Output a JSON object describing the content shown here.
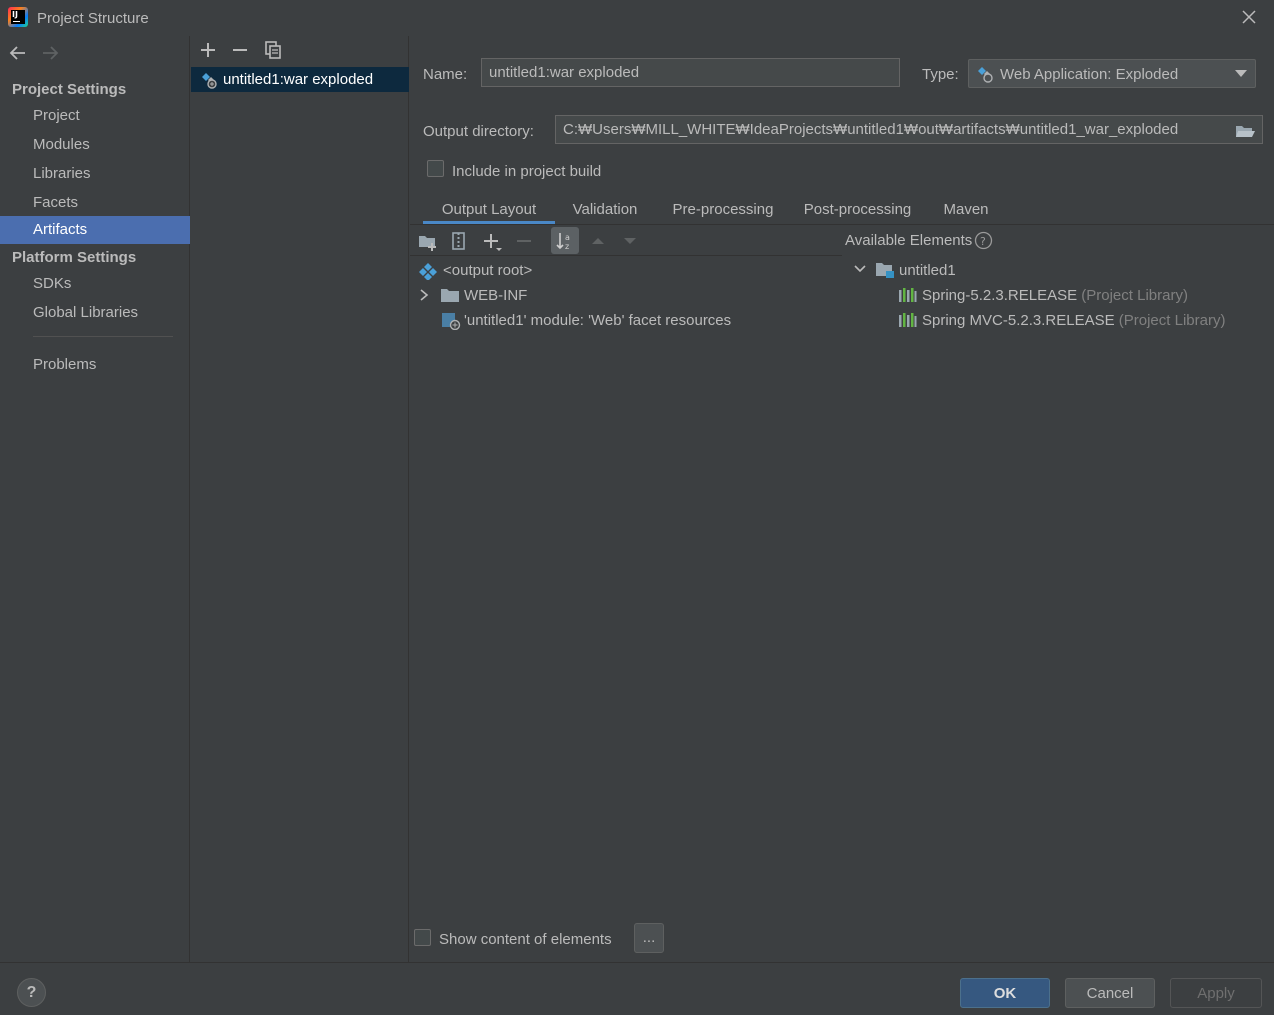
{
  "window": {
    "title": "Project Structure"
  },
  "sidebar": {
    "sections": [
      {
        "title": "Project Settings",
        "items": [
          "Project",
          "Modules",
          "Libraries",
          "Facets",
          "Artifacts"
        ]
      },
      {
        "title": "Platform Settings",
        "items": [
          "SDKs",
          "Global Libraries"
        ]
      }
    ],
    "problems": "Problems",
    "selected": "Artifacts"
  },
  "artifact_list": {
    "items": [
      "untitled1:war exploded"
    ]
  },
  "details": {
    "name_label": "Name:",
    "name_value": "untitled1:war exploded",
    "type_label": "Type:",
    "type_value": "Web Application: Exploded",
    "output_label": "Output directory:",
    "output_value": "C:₩Users₩MILL_WHITE₩IdeaProjects₩untitled1₩out₩artifacts₩untitled1_war_exploded",
    "include_label": "Include in project build",
    "include_checked": false
  },
  "tabs": [
    "Output Layout",
    "Validation",
    "Pre-processing",
    "Post-processing",
    "Maven"
  ],
  "active_tab": "Output Layout",
  "output_tree": {
    "root": "<output root>",
    "webinf": "WEB-INF",
    "facet": "'untitled1' module: 'Web' facet resources"
  },
  "available": {
    "title": "Available Elements",
    "module": "untitled1",
    "libs": [
      {
        "name": "Spring-5.2.3.RELEASE",
        "suffix": "(Project Library)"
      },
      {
        "name": "Spring MVC-5.2.3.RELEASE",
        "suffix": "(Project Library)"
      }
    ]
  },
  "show_content_label": "Show content of elements",
  "ellipsis_label": "...",
  "buttons": {
    "ok": "OK",
    "cancel": "Cancel",
    "apply": "Apply",
    "help": "?"
  },
  "colors": {
    "accent": "#4b6eaf",
    "selection_dark": "#0d293e",
    "tab_underline": "#4a88c7",
    "background": "#3c3f41"
  }
}
